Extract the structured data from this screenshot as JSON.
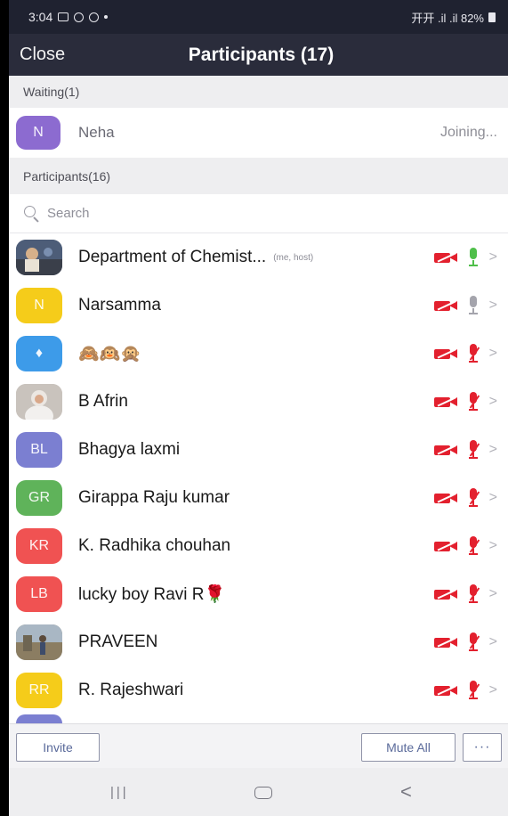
{
  "status_bar": {
    "time": "3:04",
    "right_text": "开开 .il .il 82%"
  },
  "header": {
    "close_label": "Close",
    "title": "Participants (17)"
  },
  "waiting": {
    "header": "Waiting(1)",
    "items": [
      {
        "initials": "N",
        "name": "Neha",
        "status": "Joining...",
        "color": "#8c6bd0"
      }
    ]
  },
  "participants": {
    "header": "Participants(16)",
    "search_placeholder": "Search",
    "items": [
      {
        "initials": "",
        "name": "Department of Chemist...",
        "tag": "(me, host)",
        "avatar": "photo",
        "color": "#5a6a8a",
        "mic": "on-green"
      },
      {
        "initials": "N",
        "name": "Narsamma",
        "tag": "",
        "avatar": "initials",
        "color": "#f5cc1a",
        "mic": "on-gray"
      },
      {
        "initials": "♦",
        "name": "🙈🙉🙊",
        "tag": "",
        "avatar": "initials",
        "color": "#3d9be9",
        "mic": "muted"
      },
      {
        "initials": "",
        "name": "B  Afrin",
        "tag": "",
        "avatar": "photo",
        "color": "#c8c0b8",
        "mic": "muted"
      },
      {
        "initials": "BL",
        "name": "Bhagya laxmi",
        "tag": "",
        "avatar": "initials",
        "color": "#7b7fd1",
        "mic": "muted"
      },
      {
        "initials": "GR",
        "name": "Girappa Raju kumar",
        "tag": "",
        "avatar": "initials",
        "color": "#5fb35a",
        "mic": "muted"
      },
      {
        "initials": "KR",
        "name": "K. Radhika chouhan",
        "tag": "",
        "avatar": "initials",
        "color": "#f05252",
        "mic": "muted"
      },
      {
        "initials": "LB",
        "name": "lucky boy Ravi R🌹",
        "tag": "",
        "avatar": "initials",
        "color": "#f05252",
        "mic": "muted"
      },
      {
        "initials": "",
        "name": "PRAVEEN",
        "tag": "",
        "avatar": "photo",
        "color": "#9a8a6a",
        "mic": "muted"
      },
      {
        "initials": "RR",
        "name": "R. Rajeshwari",
        "tag": "",
        "avatar": "initials",
        "color": "#f5cc1a",
        "mic": "muted"
      }
    ]
  },
  "actions": {
    "invite_label": "Invite",
    "mute_all_label": "Mute All",
    "more_label": "···"
  },
  "colors": {
    "header_bg": "#2a2c3b",
    "muted_red": "#e3202e",
    "unmuted_green": "#4fbf4a",
    "button_text": "#5a6a9a"
  }
}
